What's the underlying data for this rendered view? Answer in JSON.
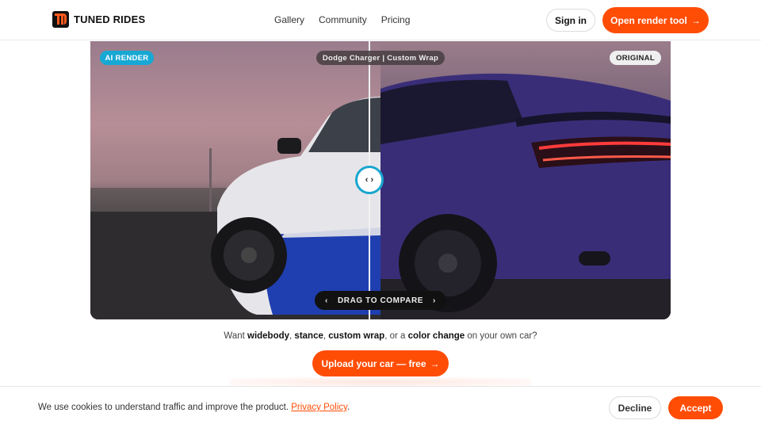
{
  "header": {
    "brand": "TUNED RIDES",
    "nav": [
      "Gallery",
      "Community",
      "Pricing"
    ],
    "signin_label": "Sign in",
    "open_tool_label": "Open render tool",
    "arrow": "→"
  },
  "viewer": {
    "left_badge": "AI RENDER",
    "model_badge": "Dodge Charger | Custom Wrap",
    "right_badge": "ORIGINAL",
    "handle_glyph": "‹ ›",
    "drag_label": "DRAG TO COMPARE",
    "drag_left": "‹",
    "drag_right": "›",
    "split_fraction": 0.48
  },
  "cta": {
    "tagline_prefix": "Want ",
    "kw1": "widebody",
    "sep1": ", ",
    "kw2": "stance",
    "sep2": ", ",
    "kw3": "custom wrap",
    "sep3": ", or a ",
    "kw4": "color change",
    "tagline_suffix": " on your own car?",
    "upload_label": "Upload your car — free",
    "arrow": "→"
  },
  "cookie": {
    "text": "We use cookies to understand traffic and improve the product.",
    "link": "Privacy Policy",
    "period": ".",
    "decline_label": "Decline",
    "accept_label": "Accept"
  },
  "colors": {
    "accent": "#ff4d06",
    "ai_badge": "#17a8d4",
    "wrap_blue": "#1f3fb0",
    "car_purple": "#3a2d78"
  }
}
